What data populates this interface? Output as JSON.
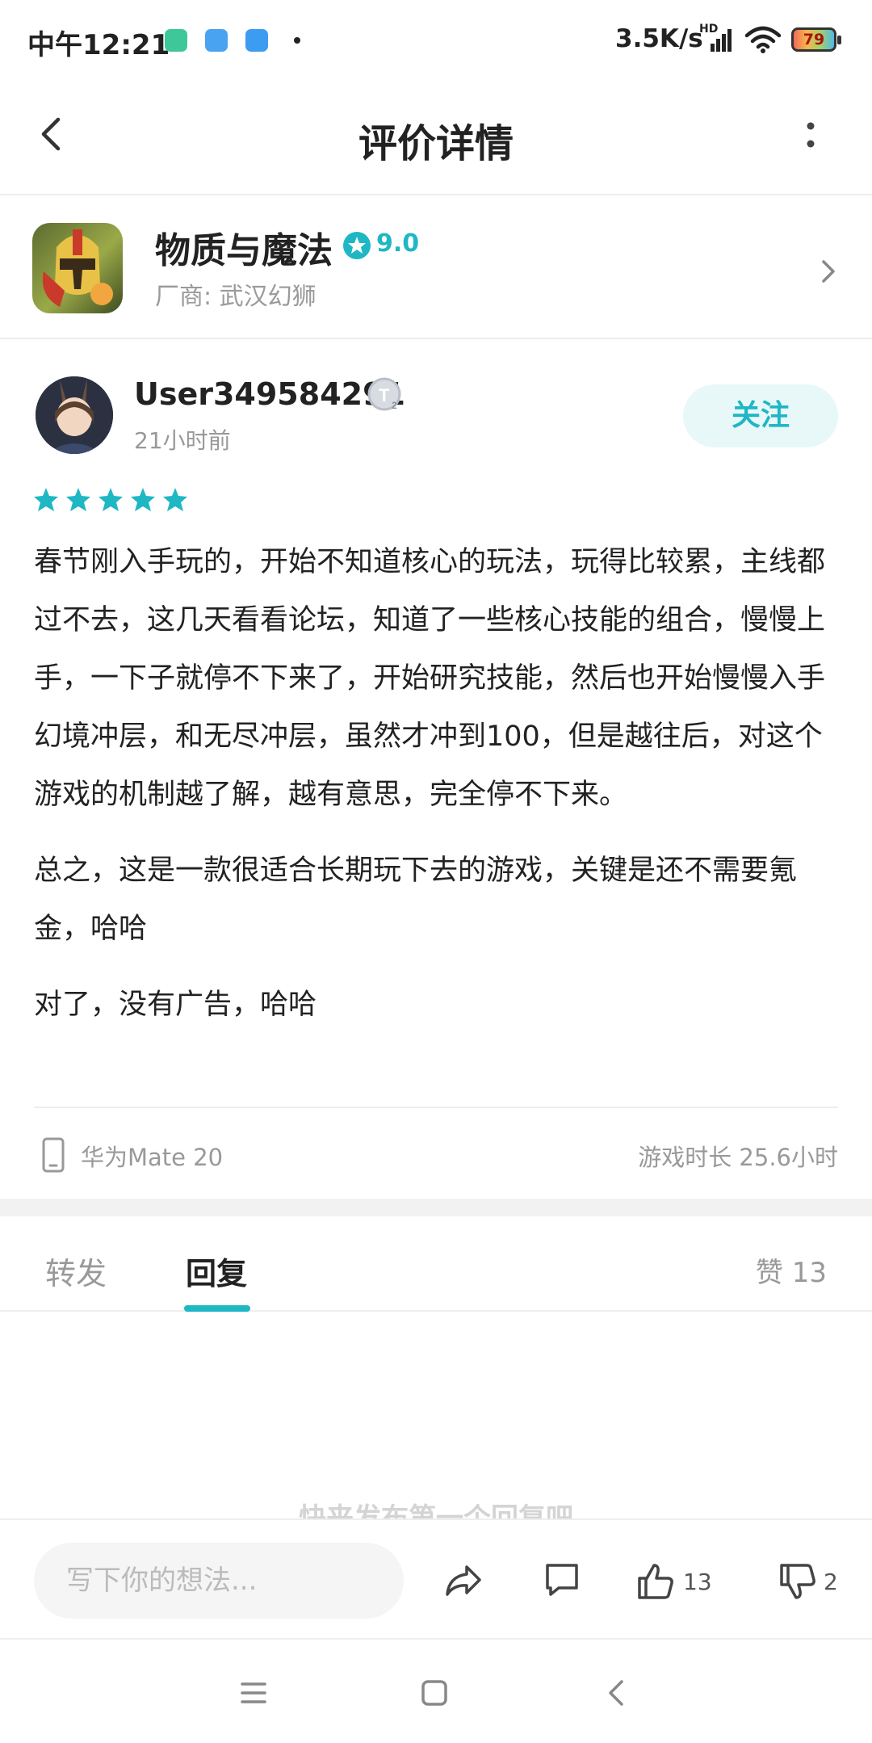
{
  "status_bar": {
    "time": "中午12:21",
    "net_speed": "3.5K/s",
    "hd_label": "HD",
    "battery": "79",
    "notification_colors": [
      "#3ec89a",
      "#4aa3f0",
      "#3b9cf0"
    ]
  },
  "header": {
    "title": "评价详情"
  },
  "game": {
    "name": "物质与魔法",
    "rating": "9.0",
    "vendor": "厂商: 武汉幻狮"
  },
  "review": {
    "username": "User349584291",
    "badge": "T2",
    "time": "21小时前",
    "follow_label": "关注",
    "stars": 5,
    "paragraphs": [
      "春节刚入手玩的，开始不知道核心的玩法，玩得比较累，主线都过不去，这几天看看论坛，知道了一些核心技能的组合，慢慢上手，一下子就停不下来了，开始研究技能，然后也开始慢慢入手幻境冲层，和无尽冲层，虽然才冲到100，但是越往后，对这个游戏的机制越了解，越有意思，完全停不下来。",
      "总之，这是一款很适合长期玩下去的游戏，关键是还不需要氪金，哈哈",
      "对了，没有广告，哈哈"
    ],
    "device": "华为Mate 20",
    "play_time": "游戏时长 25.6小时"
  },
  "tabs": {
    "repost": "转发",
    "reply": "回复",
    "likes": "赞 13"
  },
  "empty_hint": "快来发布第一个回复吧",
  "action_bar": {
    "input_placeholder": "写下你的想法...",
    "like_count": "13",
    "dislike_count": "2"
  },
  "colors": {
    "accent": "#1fb7c4",
    "follow_bg": "#e8f8f9",
    "star": "#1fb7c4"
  }
}
